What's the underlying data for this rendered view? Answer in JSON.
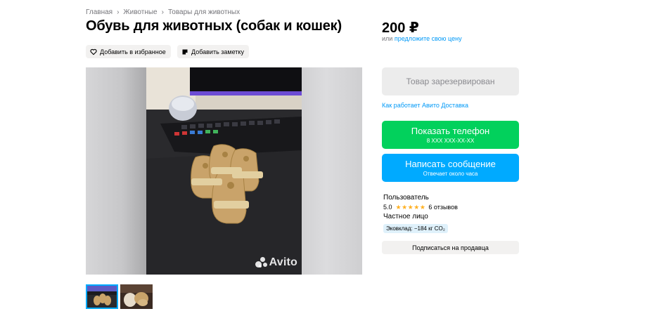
{
  "breadcrumb": [
    "Главная",
    "Животные",
    "Товары для животных"
  ],
  "breadcrumb_separator": "›",
  "title": "Обувь для животных (собак и кошек)",
  "actions": {
    "favorite_label": "Добавить в избранное",
    "note_label": "Добавить заметку"
  },
  "gallery": {
    "watermark": "Avito",
    "thumbnail_count": 2,
    "active_thumbnail": 1
  },
  "price": {
    "value": "200 ₽",
    "offer_prefix": "или",
    "offer_link": "предложите свою цену"
  },
  "buttons": {
    "reserved": "Товар зарезервирован",
    "phone": {
      "label": "Показать телефон",
      "number": "8 XXX XXX-XX-XX"
    },
    "message": {
      "label": "Написать сообщение",
      "subtitle": "Отвечает около часа"
    },
    "subscribe": "Подписаться на продавца"
  },
  "delivery_link": "Как работает Авито Доставка",
  "seller": {
    "name": "Пользователь",
    "rating": "5.0",
    "stars": 5,
    "reviews": "6 отзывов",
    "type": "Частное лицо",
    "eco": "Эковклад: −184 кг CO₂"
  },
  "colors": {
    "accent_blue": "#00aaff",
    "link_blue": "#0099f7",
    "green": "#02d15c",
    "star": "#ffb021"
  }
}
